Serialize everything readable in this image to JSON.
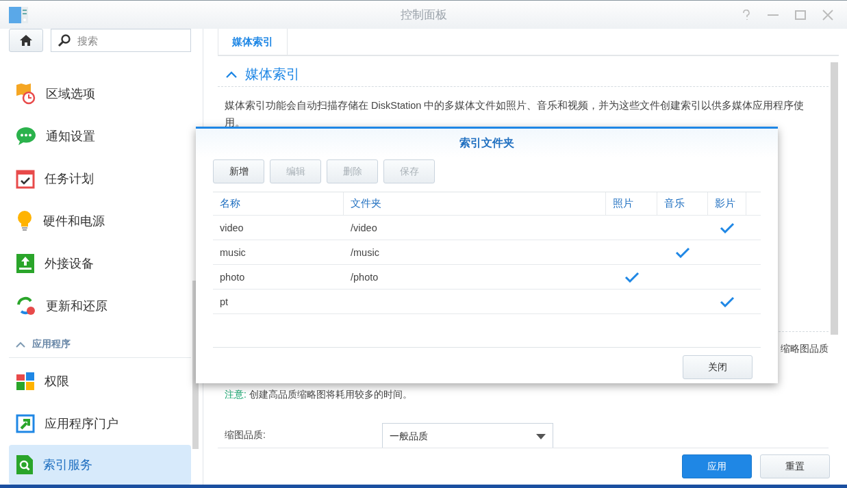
{
  "window": {
    "title": "控制面板"
  },
  "sidebar": {
    "search": {
      "placeholder": "搜索"
    },
    "items": [
      {
        "kind": "item",
        "label": "区域选项",
        "selected": false
      },
      {
        "kind": "item",
        "label": "通知设置",
        "selected": false
      },
      {
        "kind": "item",
        "label": "任务计划",
        "selected": false
      },
      {
        "kind": "item",
        "label": "硬件和电源",
        "selected": false
      },
      {
        "kind": "item",
        "label": "外接设备",
        "selected": false
      },
      {
        "kind": "item",
        "label": "更新和还原",
        "selected": false
      },
      {
        "kind": "section",
        "label": "应用程序",
        "expanded": true
      },
      {
        "kind": "item",
        "label": "权限",
        "selected": false
      },
      {
        "kind": "item",
        "label": "应用程序门户",
        "selected": false
      },
      {
        "kind": "item",
        "label": "索引服务",
        "selected": true
      }
    ]
  },
  "tabs": [
    {
      "label": "媒体索引",
      "selected": true
    }
  ],
  "section": {
    "title": "媒体索引",
    "expanded": true,
    "description": "媒体索引功能会自动扫描存储在 DiskStation 中的多媒体文件如照片、音乐和视频，并为这些文件创建索引以供多媒体应用程序使用。",
    "partial_text": "缩略图品质",
    "note_label": "注意:",
    "note_text": "创建高品质缩略图将耗用较多的时间。",
    "quality": {
      "label": "缩图品质:",
      "value": "一般品质"
    }
  },
  "buttons": [
    {
      "label": "应用",
      "kind": "primary"
    },
    {
      "label": "重置",
      "kind": "default"
    }
  ],
  "dialog": {
    "title": "索引文件夹",
    "toolbar": [
      {
        "label": "新增",
        "disabled": false
      },
      {
        "label": "编辑",
        "disabled": true
      },
      {
        "label": "删除",
        "disabled": true
      },
      {
        "label": "保存",
        "disabled": true
      }
    ],
    "columns": [
      "名称",
      "文件夹",
      "照片",
      "音乐",
      "影片"
    ],
    "rows": [
      {
        "name": "video",
        "folder": "/video",
        "photo": false,
        "music": false,
        "video": true
      },
      {
        "name": "music",
        "folder": "/music",
        "photo": false,
        "music": true,
        "video": false
      },
      {
        "name": "photo",
        "folder": "/photo",
        "photo": true,
        "music": false,
        "video": false
      },
      {
        "name": "pt",
        "photo": false,
        "music": false,
        "video": true
      }
    ],
    "close": "关闭"
  }
}
